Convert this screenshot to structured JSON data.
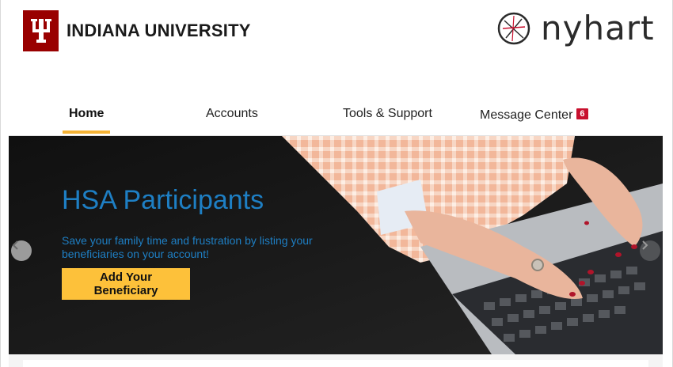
{
  "header": {
    "university_name": "INDIANA UNIVERSITY",
    "partner_name": "nyhart"
  },
  "nav": {
    "tabs": [
      {
        "label": "Home",
        "active": true
      },
      {
        "label": "Accounts",
        "active": false
      },
      {
        "label": "Tools & Support",
        "active": false
      },
      {
        "label": "Message Center",
        "active": false
      }
    ],
    "message_count": "6"
  },
  "hero": {
    "title": "HSA Participants",
    "text": "Save your family time and frustration by listing your beneficiaries on your account!",
    "button_label": "Add Your Beneficiary"
  },
  "colors": {
    "iu_crimson": "#990000",
    "accent_yellow": "#fdc13a",
    "hero_blue": "#1e7fc4",
    "badge_red": "#c8102e"
  },
  "icons": {
    "carousel_prev": "chevron-left-icon",
    "carousel_next": "chevron-right-icon"
  }
}
